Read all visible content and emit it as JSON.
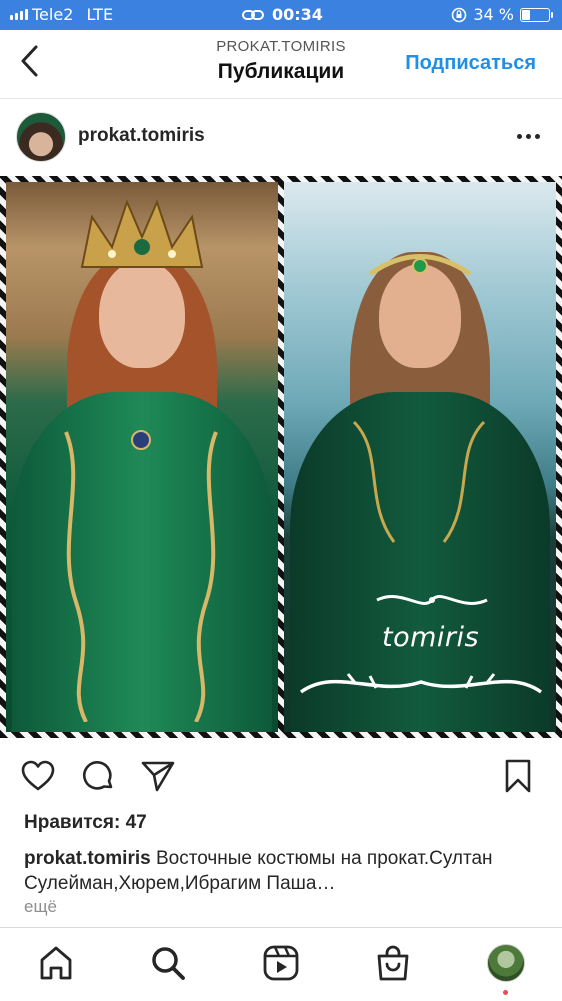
{
  "status_bar": {
    "carrier": "Tele2",
    "network": "LTE",
    "time": "00:34",
    "battery_text": "34 %",
    "battery_level": 0.34
  },
  "header": {
    "account_caps": "PROKAT.TOMIRIS",
    "title": "Публикации",
    "subscribe_label": "Подписаться"
  },
  "post": {
    "username": "prokat.tomiris",
    "image_watermark": "tomiris",
    "likes": "Нравится: 47",
    "caption_user": "prokat.tomiris",
    "caption_text": " Восточные костюмы на прокат.Султан Сулейман,Хюрем,Ибрагим Паша…",
    "more_label": "ещё"
  },
  "icons": {
    "back": "chevron-left-icon",
    "more": "more-horizontal-icon",
    "like": "heart-icon",
    "comment": "comment-icon",
    "share": "send-icon",
    "save": "bookmark-icon",
    "home": "home-icon",
    "search": "search-icon",
    "reels": "reels-icon",
    "shop": "shop-icon"
  },
  "colors": {
    "status_bar": "#3b82e0",
    "accent": "#1f8fe8",
    "notification_dot": "#ed4956"
  }
}
